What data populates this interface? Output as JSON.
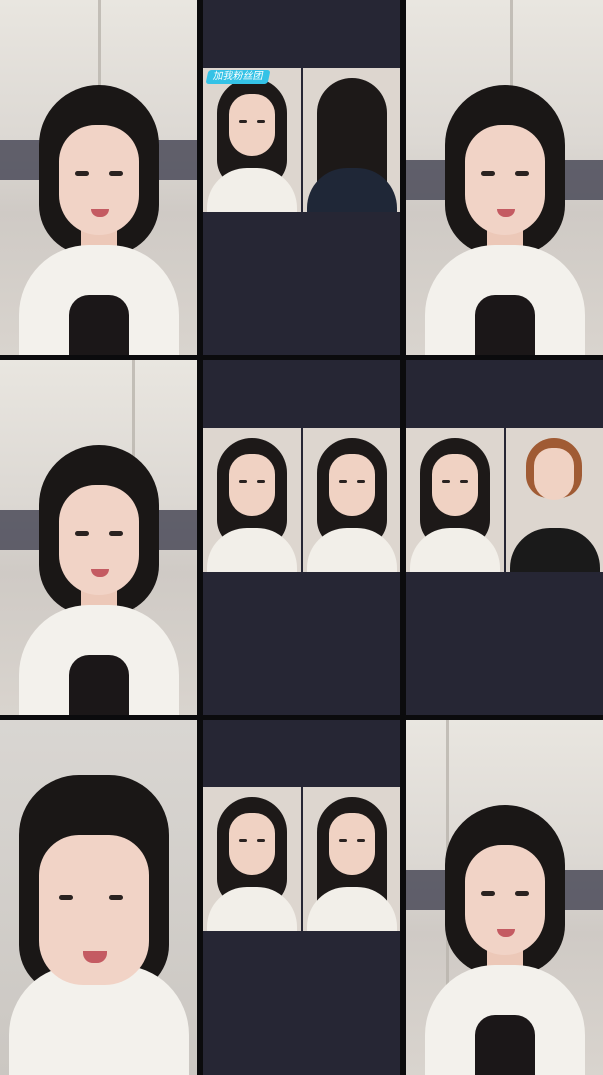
{
  "tiles": [
    {
      "id": "r1c1",
      "kind": "single"
    },
    {
      "id": "r1c2",
      "kind": "split",
      "sticker_text": "加我粉丝团"
    },
    {
      "id": "r1c3",
      "kind": "single"
    },
    {
      "id": "r2c1",
      "kind": "single"
    },
    {
      "id": "r2c2",
      "kind": "split"
    },
    {
      "id": "r2c3",
      "kind": "split"
    },
    {
      "id": "r3c1",
      "kind": "single"
    },
    {
      "id": "r3c2",
      "kind": "split"
    },
    {
      "id": "r3c3",
      "kind": "single"
    }
  ],
  "colors": {
    "tile_background": "#262634",
    "grid_gap": "#0b0b0d"
  }
}
